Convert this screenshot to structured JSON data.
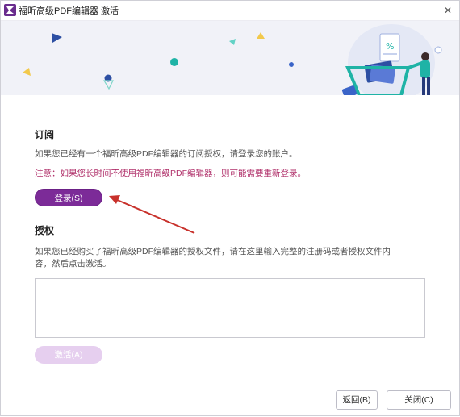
{
  "window": {
    "title": "福昕高级PDF编辑器 激活",
    "close_glyph": "✕"
  },
  "subscription": {
    "heading": "订阅",
    "description": "如果您已经有一个福昕高级PDF编辑器的订阅授权，请登录您的账户。",
    "note": "注意：如果您长时间不使用福昕高级PDF编辑器，则可能需要重新登录。",
    "login_label": "登录(S)"
  },
  "license": {
    "heading": "授权",
    "description_line1": "如果您已经购买了福昕高级PDF编辑器的授权文件，请在这里输入完整的注册码或者授权文件内",
    "description_line2": "容，然后点击激活。",
    "input_value": "",
    "activate_label": "激活(A)"
  },
  "footer": {
    "back_label": "返回(B)",
    "close_label": "关闭(C)"
  },
  "colors": {
    "accent": "#7c2b98",
    "note": "#b0306a",
    "activate_disabled": "#e6cfef",
    "banner_bg": "#f1f2f8"
  },
  "icons": [
    "app-logo-icon",
    "close-icon",
    "shopping-cart-illustration",
    "annotation-arrow"
  ]
}
